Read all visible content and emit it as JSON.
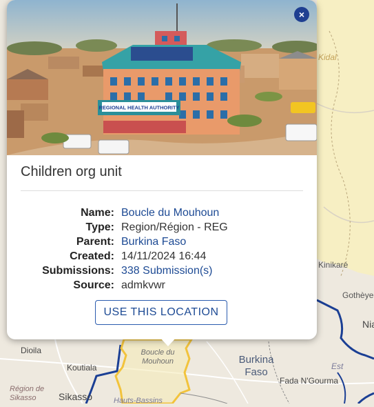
{
  "map": {
    "labels": [
      {
        "id": "kidal",
        "text": "Kidal"
      },
      {
        "id": "kinikare",
        "text": "Kinikaré"
      },
      {
        "id": "gothey",
        "text": "Gothèye"
      },
      {
        "id": "nia",
        "text": "Nia"
      },
      {
        "id": "dioila",
        "text": "Dioila"
      },
      {
        "id": "koutiala",
        "text": "Koutiala"
      },
      {
        "id": "region-sikasso",
        "text": "Région de Sikasso"
      },
      {
        "id": "sikasso",
        "text": "Sikasso"
      },
      {
        "id": "boucle-du-mouhoun",
        "text": "Boucle du Mouhoun"
      },
      {
        "id": "burkina-faso",
        "text": "Burkina Faso"
      },
      {
        "id": "est",
        "text": "Est"
      },
      {
        "id": "fada",
        "text": "Fada N'Gourma"
      },
      {
        "id": "hauts-bassins",
        "text": "Hauts-Bassins"
      }
    ],
    "colors": {
      "land": "#eee9df",
      "highlight": "#f7efc3",
      "region_border": "#f2c33c",
      "country_border": "#1b3f94"
    }
  },
  "popup": {
    "photo_sign": "REGIONAL HEALTH AUTHORITY",
    "close_icon": "×",
    "title": "Children org unit",
    "details": [
      {
        "label": "Name:",
        "value": "Boucle du Mouhoun",
        "link": true
      },
      {
        "label": "Type:",
        "value": "Region/Région - REG",
        "link": false
      },
      {
        "label": "Parent:",
        "value": "Burkina Faso",
        "link": true
      },
      {
        "label": "Created:",
        "value": "14/11/2024 16:44",
        "link": false
      },
      {
        "label": "Submissions:",
        "value": "338 Submission(s)",
        "link": true
      },
      {
        "label": "Source:",
        "value": "admkvwr",
        "link": false
      }
    ],
    "use_button": "USE THIS LOCATION"
  }
}
